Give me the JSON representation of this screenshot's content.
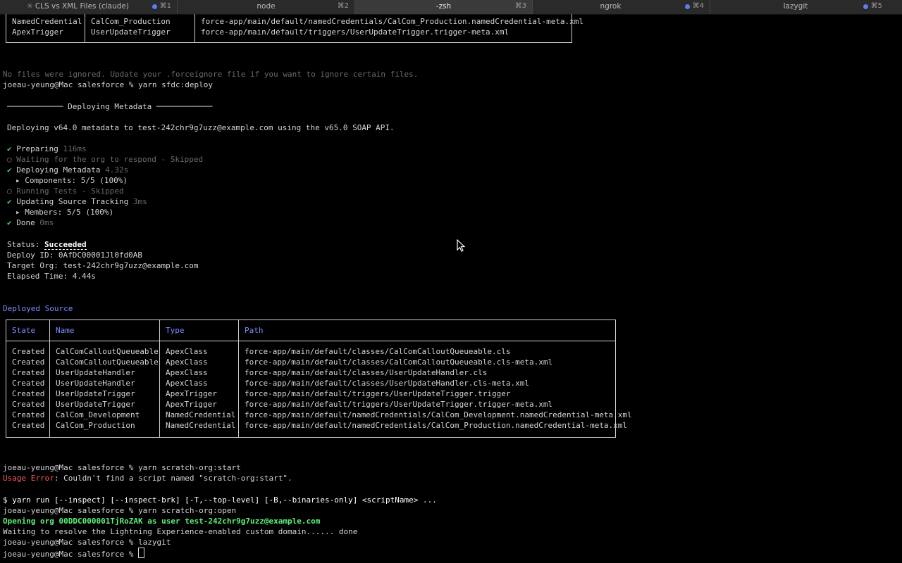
{
  "tabs": [
    {
      "title": "CLS vs XML Files (claude)",
      "shortcut": "⌘1",
      "spinner": "✳"
    },
    {
      "title": "node",
      "shortcut": "⌘2"
    },
    {
      "title": "-zsh",
      "shortcut": "⌘3"
    },
    {
      "title": "ngrok",
      "shortcut": "⌘4"
    },
    {
      "title": "lazygit",
      "shortcut": "⌘5"
    }
  ],
  "top_table": {
    "rows": [
      {
        "type": "NamedCredential",
        "name": "CalCom_Production",
        "path": "force-app/main/default/namedCredentials/CalCom_Production.namedCredential-meta.xml"
      },
      {
        "type": "ApexTrigger",
        "name": "UserUpdateTrigger",
        "path": "force-app/main/default/triggers/UserUpdateTrigger.trigger-meta.xml"
      }
    ]
  },
  "ignored_msg": "No files were ignored. Update your .forceignore file if you want to ignore certain files.",
  "prompt": "joeau-yeung@Mac salesforce % ",
  "cmd_deploy": "yarn sfdc:deploy",
  "deploy_header": "──────────── Deploying Metadata ────────────",
  "deploy_desc": "Deploying v64.0 metadata to test-242chr9g7uzz@example.com using the v65.0 SOAP API.",
  "check": "✔",
  "circle": "◯",
  "arrow": "▸",
  "steps": {
    "preparing": "Preparing",
    "preparing_t": "116ms",
    "waiting": "Waiting for the org to respond - Skipped",
    "deploying": "Deploying Metadata",
    "deploying_t": "4.32s",
    "components": "Components: 5/5 (100%)",
    "running": "Running Tests - Skipped",
    "updating": "Updating Source Tracking",
    "updating_t": "3ms",
    "members": "Members: 5/5 (100%)",
    "done": "Done",
    "done_t": "0ms"
  },
  "status": {
    "label": "Status: ",
    "value": "Succeeded",
    "deploy_id": "Deploy ID: 0AfDC00001Jl0fd0AB",
    "target": "Target Org: test-242chr9g7uzz@example.com",
    "elapsed": "Elapsed Time: 4.44s"
  },
  "deployed_title": "Deployed Source",
  "deployed_table": {
    "headers": [
      "State",
      "Name",
      "Type",
      "Path"
    ],
    "rows": [
      {
        "state": "Created",
        "name": "CalComCalloutQueueable",
        "type": "ApexClass",
        "path": "force-app/main/default/classes/CalComCalloutQueueable.cls"
      },
      {
        "state": "Created",
        "name": "CalComCalloutQueueable",
        "type": "ApexClass",
        "path": "force-app/main/default/classes/CalComCalloutQueueable.cls-meta.xml"
      },
      {
        "state": "Created",
        "name": "UserUpdateHandler",
        "type": "ApexClass",
        "path": "force-app/main/default/classes/UserUpdateHandler.cls"
      },
      {
        "state": "Created",
        "name": "UserUpdateHandler",
        "type": "ApexClass",
        "path": "force-app/main/default/classes/UserUpdateHandler.cls-meta.xml"
      },
      {
        "state": "Created",
        "name": "UserUpdateTrigger",
        "type": "ApexTrigger",
        "path": "force-app/main/default/triggers/UserUpdateTrigger.trigger"
      },
      {
        "state": "Created",
        "name": "UserUpdateTrigger",
        "type": "ApexTrigger",
        "path": "force-app/main/default/triggers/UserUpdateTrigger.trigger-meta.xml"
      },
      {
        "state": "Created",
        "name": "CalCom_Development",
        "type": "NamedCredential",
        "path": "force-app/main/default/namedCredentials/CalCom_Development.namedCredential-meta.xml"
      },
      {
        "state": "Created",
        "name": "CalCom_Production",
        "type": "NamedCredential",
        "path": "force-app/main/default/namedCredentials/CalCom_Production.namedCredential-meta.xml"
      }
    ]
  },
  "cmd_start": "yarn scratch-org:start",
  "usage_error_label": "Usage Error",
  "usage_error_msg": ": Couldn't find a script named \"scratch-org:start\".",
  "usage_line": "$ yarn run [--inspect] [--inspect-brk] [-T,--top-level] [-B,--binaries-only] <scriptName> ...",
  "cmd_open": "yarn scratch-org:open",
  "opening_msg": "Opening org 00DDC000001TjRoZAK as user test-242chr9g7uzz@example.com",
  "waiting_msg": "Waiting to resolve the Lightning Experience-enabled custom domain...... done",
  "cmd_lazygit": "lazygit",
  "colors": {
    "accent": "#7b8cff",
    "success": "#45d162",
    "error": "#ff5a5a",
    "tab_dot": "#5b7cf2"
  }
}
